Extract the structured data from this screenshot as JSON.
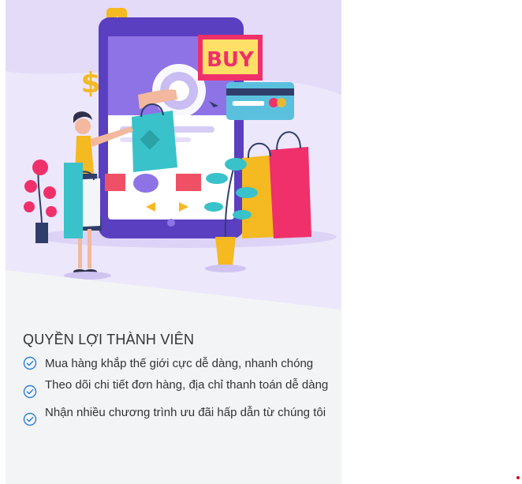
{
  "hero": {
    "sign_text": "BUY"
  },
  "benefits": {
    "title": "QUYỀN LỢI THÀNH VIÊN",
    "items": [
      {
        "text": "Mua hàng khắp thế giới cực dễ dàng, nhanh chóng"
      },
      {
        "text": "Theo dõi chi tiết đơn hàng, địa chỉ thanh toán dễ dàng"
      },
      {
        "text": "Nhận nhiều chương trình ưu đãi hấp dẫn từ chúng tôi"
      }
    ]
  },
  "colors": {
    "panel_bg": "#f3f4f6",
    "hero_bg": "#ece6fb",
    "accent": "#2a7fd4",
    "tablet": "#5a3fc0",
    "dot": "#d0021b"
  },
  "icons": [
    "check-circle-icon",
    "dollar-icon",
    "cursor-icon"
  ]
}
